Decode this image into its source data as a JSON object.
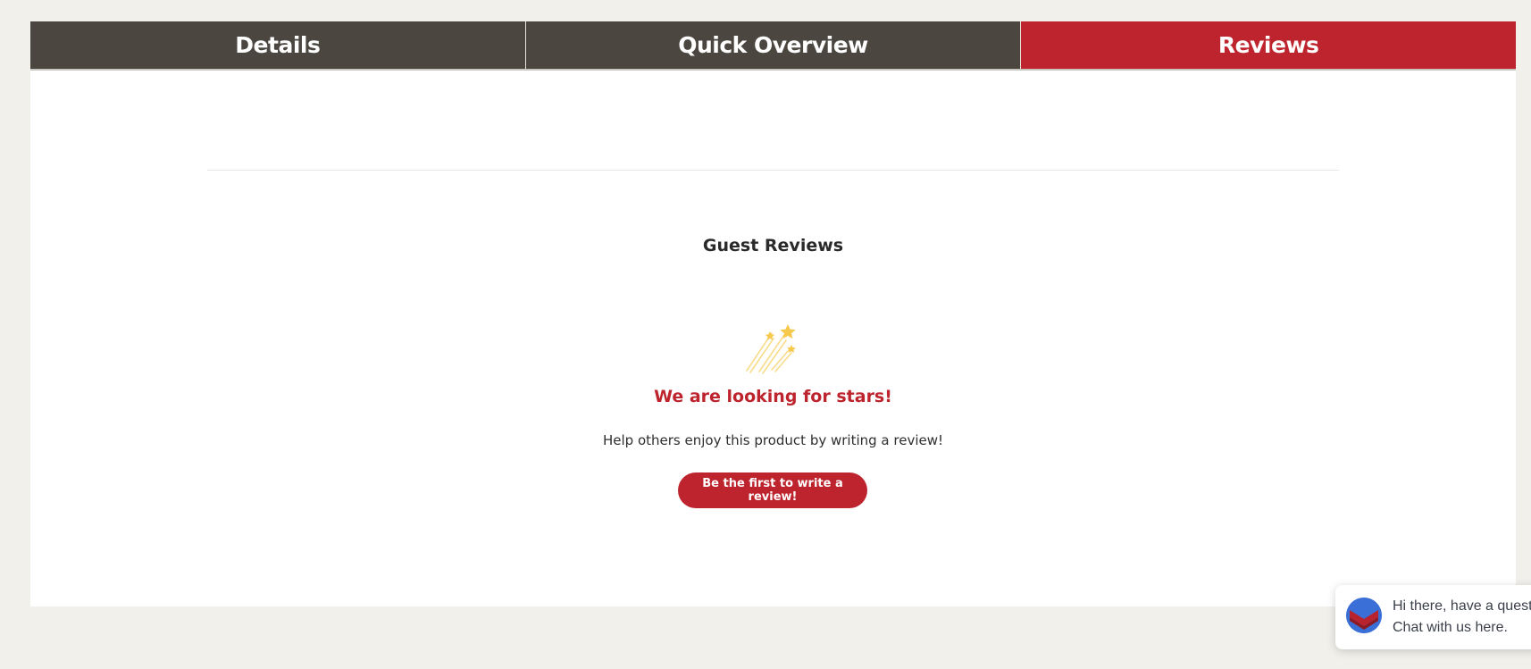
{
  "tabs": [
    {
      "label": "Details",
      "active": false
    },
    {
      "label": "Quick Overview",
      "active": false
    },
    {
      "label": "Reviews",
      "active": true
    }
  ],
  "reviews": {
    "section_title": "Guest Reviews",
    "empty_title": "We are looking for stars!",
    "empty_subtitle": "Help others enjoy this product by writing a review!",
    "cta_label": "Be the first to write a review!",
    "icon": "shooting-stars-icon"
  },
  "chat": {
    "line1": "Hi there, have a quest",
    "line2": "Chat with us here.",
    "avatar_icon": "chat-logo-icon"
  },
  "colors": {
    "accent": "#be242d",
    "tab_background": "#4b4640",
    "page_background": "#f1f0eb",
    "chat_avatar": "#3a6fd8"
  }
}
